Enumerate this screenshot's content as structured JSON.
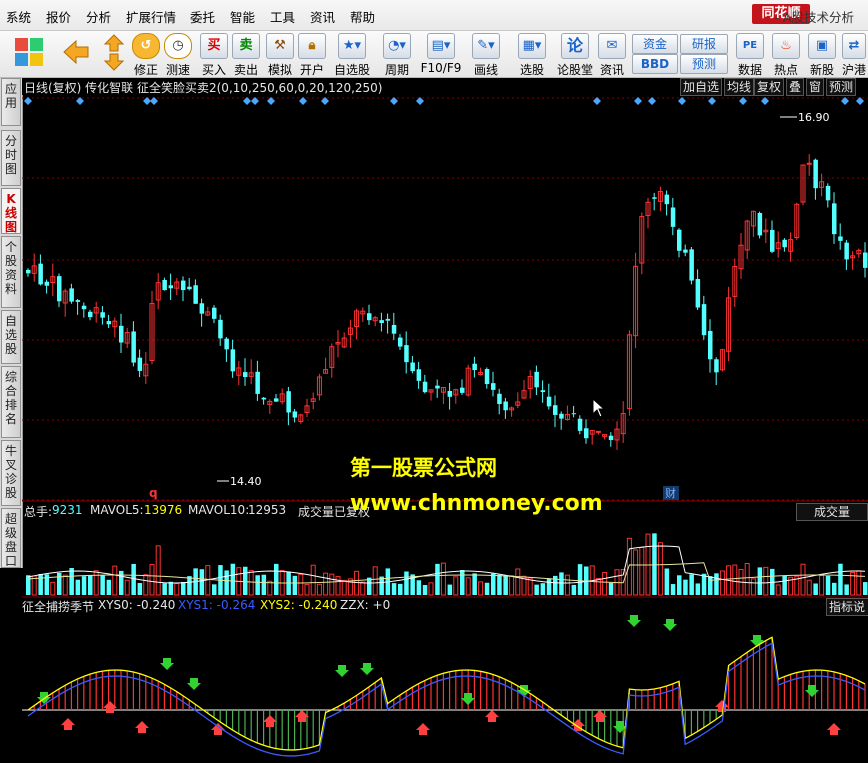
{
  "menu": [
    "系统",
    "报价",
    "分析",
    "扩展行情",
    "委托",
    "智能",
    "工具",
    "资讯",
    "帮助"
  ],
  "brand": {
    "logo_text": "同花顺",
    "title": "- A股技术分析"
  },
  "toolbar": {
    "buttons": [
      {
        "label": "修正",
        "icon": "adjust-icon"
      },
      {
        "label": "测速",
        "icon": "clock-icon"
      },
      {
        "label": "买入",
        "icon": "buy-icon",
        "glyph": "买"
      },
      {
        "label": "卖出",
        "icon": "sell-icon",
        "glyph": "卖"
      },
      {
        "label": "模拟",
        "icon": "hammer-icon"
      },
      {
        "label": "开户",
        "icon": "lock-icon"
      },
      {
        "label": "自选股",
        "icon": "star-icon"
      },
      {
        "label": "周期",
        "icon": "cycle-icon"
      },
      {
        "label": "F10/F9",
        "icon": "f10-icon"
      },
      {
        "label": "画线",
        "icon": "pen-icon"
      },
      {
        "label": "选股",
        "icon": "screen-icon"
      },
      {
        "label": "论股堂",
        "icon": "forum-icon",
        "glyph": "论"
      },
      {
        "label": "资讯",
        "icon": "news-icon"
      },
      {
        "label": "数据",
        "icon": "pe-icon",
        "glyph": "PE"
      },
      {
        "label": "热点",
        "icon": "hot-icon"
      },
      {
        "label": "新股",
        "icon": "ipo-icon"
      },
      {
        "label": "沪港",
        "icon": "hk-icon"
      }
    ],
    "fund": "资金",
    "bbd": "BBD",
    "research": "研报",
    "forecast": "预测"
  },
  "sidebar": [
    "应用",
    "分时图",
    "K线图",
    "个股资料",
    "自选股",
    "综合排名",
    "牛叉诊股",
    "超级盘口"
  ],
  "chart": {
    "header_left": "日线(复权)  传化智联  征全笑脸买卖2(0,10,250,60,0,20,120,250)",
    "header_buttons": [
      "加自选",
      "均线",
      "复权",
      "叠",
      "窗",
      "预测"
    ],
    "high_label": "16.90",
    "low_label": "14.40",
    "marker_q": "q",
    "marker_cai": "财"
  },
  "volume": {
    "total_label": "总手:",
    "total_value": "9231",
    "mavol5_label": "MAVOL5:",
    "mavol5_value": "13976",
    "mavol10_label": "MAVOL10:",
    "mavol10_value": "12953",
    "note": "成交量已复权",
    "button": "成交量"
  },
  "indicator": {
    "name": "征全捕捞季节",
    "xys0": "XYS0: -0.240",
    "xys1": "XYS1: -0.264",
    "xys2": "XYS2: -0.240",
    "zzx": "ZZX: +0",
    "button": "指标说"
  },
  "watermark": {
    "line1": "第一股票公式网",
    "line2": "www.chnmoney.com"
  },
  "colors": {
    "up": "#ff3232",
    "down": "#54ffff",
    "brand": "#c3141c",
    "watermark": "#ffff00"
  }
}
